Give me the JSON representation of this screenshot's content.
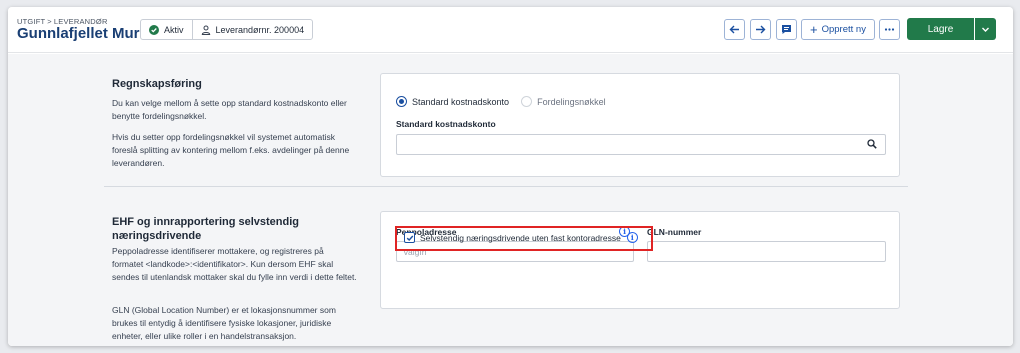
{
  "header": {
    "breadcrumb": [
      "UTGIFT",
      "LEVERANDØR"
    ],
    "breadcrumb_separator": ">",
    "title": "Gunnlafjellet Mur",
    "status_chip": {
      "label": "Aktiv",
      "icon": "check-circle-icon"
    },
    "supplier_chip": {
      "label": "Leverandørnr. 200004",
      "icon": "user-icon"
    },
    "toolbar": {
      "back_icon": "arrow-left-icon",
      "forward_icon": "arrow-right-icon",
      "comment_icon": "comment-icon",
      "create_new_label": "Opprett ny",
      "more_icon": "more-icon",
      "save_label": "Lagre",
      "save_menu_icon": "chevron-down-icon"
    }
  },
  "accounting": {
    "title": "Regnskapsføring",
    "description_1": "Du kan velge mellom å sette opp standard kostnadskonto eller benytte fordelingsnøkkel.",
    "description_2": "Hvis du setter opp fordelingsnøkkel vil systemet automatisk foreslå splitting av kontering mellom f.eks. avdelinger på denne leverandøren.",
    "options": [
      {
        "label": "Standard kostnadskonto",
        "selected": true
      },
      {
        "label": "Fordelingsnøkkel",
        "selected": false
      }
    ],
    "account_field_label": "Standard kostnadskonto",
    "account_field_value": "",
    "search_icon": "search-icon"
  },
  "ehf": {
    "title": "EHF og innrapportering selvstendig næringsdrivende",
    "description_1": "Peppoladresse identifiserer mottakere, og registreres på formatet <landkode>:<identifikator>. Kun dersom EHF skal sendes til utenlandsk mottaker skal du fylle inn verdi i dette feltet.",
    "description_2": "GLN (Global Location Number) er et lokasjonsnummer som brukes til entydig å identifisere fysiske lokasjoner, juridiske enheter, eller ulike roller i en handelstransaksjon.",
    "peppol_label": "Peppoladresse",
    "peppol_placeholder": "Valgfri",
    "gln_label": "GLN-nummer",
    "gln_value": "",
    "checkbox_label": "Selvstendig næringsdrivende uten fast kontoradresse",
    "checkbox_checked": true,
    "info_icon": "info-icon"
  },
  "colors": {
    "title_blue": "#1a3f74",
    "accent_blue": "#1a4fa0",
    "save_green": "#217a4a",
    "highlight_red": "#e02424"
  }
}
